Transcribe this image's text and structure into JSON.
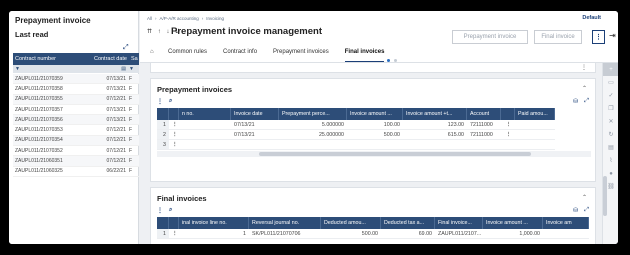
{
  "left_panel": {
    "title": "Prepayment invoice",
    "subtitle": "Last read",
    "columns": [
      "Contract number",
      "Contract date",
      "Sa"
    ],
    "rows": [
      {
        "contract": "ZAUPL011/21070359",
        "date": "07/13/21",
        "flag": "F"
      },
      {
        "contract": "ZAUPL011/21070358",
        "date": "07/13/21",
        "flag": "F"
      },
      {
        "contract": "ZAUPL011/21070355",
        "date": "07/12/21",
        "flag": "F"
      },
      {
        "contract": "ZAUPL011/21070357",
        "date": "07/13/21",
        "flag": "F"
      },
      {
        "contract": "ZAUPL011/21070356",
        "date": "07/13/21",
        "flag": "F"
      },
      {
        "contract": "ZAUPL011/21070353",
        "date": "07/12/21",
        "flag": "F"
      },
      {
        "contract": "ZAUPL011/21070354",
        "date": "07/12/21",
        "flag": "F"
      },
      {
        "contract": "ZAUPL011/21070352",
        "date": "07/12/21",
        "flag": "F"
      },
      {
        "contract": "ZAUPL011/21060351",
        "date": "07/12/21",
        "flag": "F"
      },
      {
        "contract": "ZAUPL011/21060325",
        "date": "06/22/21",
        "flag": "F"
      }
    ]
  },
  "header": {
    "breadcrumbs": [
      "All",
      "A/P-A/R accounting",
      "Invoicing"
    ],
    "default_label": "Default",
    "nav_arrows": "⇈ ↑ ↓ ⇊",
    "title": "Prepayment invoice management",
    "btn_prepayment": "Prepayment invoice",
    "btn_final": "Final invoice",
    "btn_more": "⋮",
    "tabs": [
      "Common rules",
      "Contract info",
      "Prepayment invoices",
      "Final invoices"
    ]
  },
  "prepayment": {
    "title": "Prepayment invoices",
    "columns": [
      "",
      "",
      "n no.",
      "Invoice date",
      "Prepayment perce...",
      "Invoice amount ...",
      "Invoice amount +t...",
      "Account",
      "",
      "Paid amou..."
    ],
    "rows": [
      {
        "rn": "1",
        "no": "",
        "date": "07/13/21",
        "pct": "5.000000",
        "amt": "100.00",
        "amt_tax": "123.00",
        "account": "72111000"
      },
      {
        "rn": "2",
        "no": "",
        "date": "07/13/21",
        "pct": "25.000000",
        "amt": "500.00",
        "amt_tax": "615.00",
        "account": "72111000"
      },
      {
        "rn": "3",
        "no": "",
        "date": "",
        "pct": "",
        "amt": "",
        "amt_tax": "",
        "account": ""
      }
    ]
  },
  "final": {
    "title": "Final invoices",
    "columns": [
      "",
      "",
      "inal invoice line no.",
      "Reversal journal no.",
      "Deducted amou...",
      "Deducted tax a...",
      "Final invoice...",
      "Invoice amount ...",
      "Invoice am"
    ],
    "rows": [
      {
        "rn": "1",
        "line": "1",
        "reversal": "SK/PL011/21070706",
        "deducted": "500.00",
        "deducted_tax": "69.00",
        "final": "ZAUPL011/2107...",
        "amount": "1,000.00"
      }
    ]
  }
}
